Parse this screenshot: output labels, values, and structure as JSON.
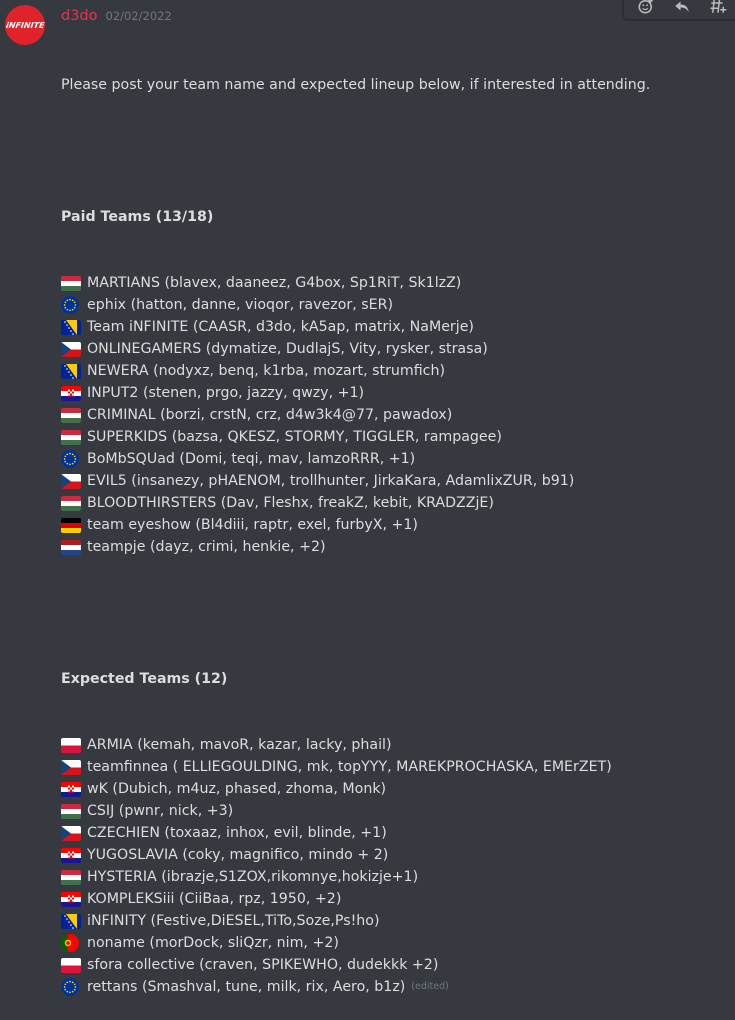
{
  "message": {
    "author": "d3do",
    "timestamp": "02/02/2022",
    "avatar_text": "iNFINITE",
    "intro": "Please post your team name and expected lineup below, if interested in attending.",
    "paid_heading": "Paid Teams (13/18)",
    "paid_teams": [
      {
        "flag": "hungary",
        "text": "MARTIANS (blavex, daaneez, G4box, Sp1RiT, Sk1lzZ)"
      },
      {
        "flag": "eu",
        "text": "ephix (hatton, danne, vioqor, ravezor, sER)"
      },
      {
        "flag": "bosnia",
        "text": "Team iNFINITE (CAASR, d3do, kA5ap, matrix, NaMerje)"
      },
      {
        "flag": "czech",
        "text": "ONLINEGAMERS (dymatize, DudlajS, Vity, rysker, strasa)"
      },
      {
        "flag": "bosnia",
        "text": "NEWERA (nodyxz, benq, k1rba, mozart, strumfich)"
      },
      {
        "flag": "croatia",
        "text": "INPUT2 (stenen, prgo, jazzy, qwzy, +1)"
      },
      {
        "flag": "hungary",
        "text": "CRIMINAL (borzi, crstN, crz, d4w3k4@77, pawadox)"
      },
      {
        "flag": "hungary",
        "text": "SUPERKIDS (bazsa, QKESZ, STORMY, TIGGLER, rampagee)"
      },
      {
        "flag": "eu",
        "text": "BoMbSQUad (Domi, teqi, mav, lamzoRRR, +1)"
      },
      {
        "flag": "czech",
        "text": "EVIL5 (insanezy, pHAENOM, trollhunter, JirkaKara, AdamlixZUR, b91)"
      },
      {
        "flag": "hungary",
        "text": "BLOODTHIRSTERS (Dav, Fleshx, freakZ, kebit, KRADZZjE)"
      },
      {
        "flag": "germany",
        "text": "team eyeshow (Bl4diii, raptr, exel, furbyX, +1)"
      },
      {
        "flag": "netherlands",
        "text": "teampje (dayz, crimi, henkie, +2)"
      }
    ],
    "expected_heading": "Expected Teams (12)",
    "expected_teams": [
      {
        "flag": "poland",
        "text": "ARMIA (kemah, mavoR, kazar, lacky, phail)"
      },
      {
        "flag": "czech",
        "text": "teamfinnea ( ELLIEGOULDING, mk, topYYY, MAREKPROCHASKA, EMErZET)"
      },
      {
        "flag": "croatia",
        "text": "wK (Dubich, m4uz, phased, zhoma, Monk)"
      },
      {
        "flag": "hungary",
        "text": "CSIJ (pwnr, nick, +3)"
      },
      {
        "flag": "czech",
        "text": "CZECHIEN (toxaaz, inhox, evil, blinde, +1)"
      },
      {
        "flag": "croatia",
        "text": "YUGOSLAVIA (coky, magnifico, mindo + 2)"
      },
      {
        "flag": "hungary",
        "text": "HYSTERIA (ibrazje,S1ZOX,rikomnye,hokizje+1)"
      },
      {
        "flag": "croatia",
        "text": "KOMPLEKSiii (CiiBaa, rpz, 1950, +2)"
      },
      {
        "flag": "bosnia",
        "text": "iNFINITY (Festive,DiESEL,TiTo,Soze,Ps!ho)"
      },
      {
        "flag": "portugal",
        "text": "noname (morDock, sliQzr, nim, +2)"
      },
      {
        "flag": "poland",
        "text": "sfora collective (craven, SPIKEWHO, dudekkk +2)"
      },
      {
        "flag": "eu",
        "text": "rettans (Smashval, tune, milk, rix, Aero, b1z)"
      }
    ],
    "edited_label": "(edited)"
  },
  "toolbar": {
    "icons": [
      "add-reaction-icon",
      "reply-icon",
      "create-thread-icon"
    ]
  }
}
